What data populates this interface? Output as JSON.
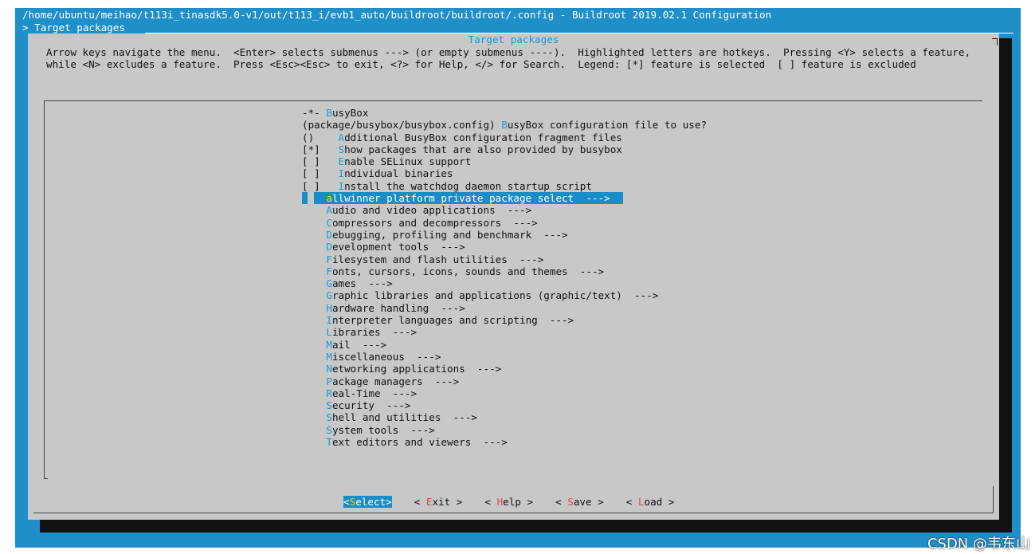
{
  "window": {
    "title": "/home/ubuntu/meihao/t113i_tinasdk5.0-v1/out/t113_i/evb1_auto/buildroot/buildroot/.config - Buildroot 2019.02.1 Configuration",
    "breadcrumb": "> Target packages"
  },
  "dialog": {
    "title": "Target packages",
    "help_line1": "Arrow keys navigate the menu.  <Enter> selects submenus ---> (or empty submenus ----).  Highlighted letters are hotkeys.  Pressing <Y> selects a feature,",
    "help_line2": "while <N> excludes a feature.  Press <Esc><Esc> to exit, <?> for Help, </> for Search.  Legend: [*] feature is selected  [ ] feature is excluded"
  },
  "menu": [
    {
      "prefix": "-*- ",
      "hot": "B",
      "rest": "usyBox"
    },
    {
      "prefix": "(package/busybox/busybox.config) ",
      "hot": "B",
      "rest": "usyBox configuration file to use?"
    },
    {
      "prefix": "()    ",
      "hot": "A",
      "rest": "dditional BusyBox configuration fragment files"
    },
    {
      "prefix": "[*]   ",
      "hot": "S",
      "rest": "how packages that are also provided by busybox"
    },
    {
      "prefix": "[ ]   ",
      "hot": "E",
      "rest": "nable SELinux support"
    },
    {
      "prefix": "[ ]   ",
      "hot": "I",
      "rest": "ndividual binaries"
    },
    {
      "prefix": "[ ]   ",
      "hot": "I",
      "rest": "nstall the watchdog daemon startup script"
    },
    {
      "prefix": "    ",
      "hot": "a",
      "rest": "llwinner platform private package select  --->",
      "selected": true
    },
    {
      "prefix": "    ",
      "hot": "A",
      "rest": "udio and video applications  --->"
    },
    {
      "prefix": "    ",
      "hot": "C",
      "rest": "ompressors and decompressors  --->"
    },
    {
      "prefix": "    ",
      "hot": "D",
      "rest": "ebugging, profiling and benchmark  --->"
    },
    {
      "prefix": "    ",
      "hot": "D",
      "rest": "evelopment tools  --->"
    },
    {
      "prefix": "    ",
      "hot": "F",
      "rest": "ilesystem and flash utilities  --->"
    },
    {
      "prefix": "    ",
      "hot": "F",
      "rest": "onts, cursors, icons, sounds and themes  --->"
    },
    {
      "prefix": "    ",
      "hot": "G",
      "rest": "ames  --->"
    },
    {
      "prefix": "    ",
      "hot": "G",
      "rest": "raphic libraries and applications (graphic/text)  --->"
    },
    {
      "prefix": "    ",
      "hot": "H",
      "pre": "",
      "rest": "ardware handling  --->",
      "hot_index": 1,
      "text": "Hardware handling  --->"
    },
    {
      "prefix": "    ",
      "hot": "I",
      "rest": "nterpreter languages and scripting  --->"
    },
    {
      "prefix": "    ",
      "hot": "L",
      "rest": "ibraries  --->"
    },
    {
      "prefix": "    ",
      "hot": "M",
      "rest": "ail  --->"
    },
    {
      "prefix": "    ",
      "hot": "M",
      "rest": "iscellaneous  --->"
    },
    {
      "prefix": "    ",
      "hot": "N",
      "rest": "etworking applications  --->"
    },
    {
      "prefix": "    ",
      "hot": "P",
      "rest": "ackage managers  --->"
    },
    {
      "prefix": "    ",
      "hot": "R",
      "rest": "eal-Time  --->"
    },
    {
      "prefix": "    ",
      "hot": "S",
      "rest": "ecurity  --->"
    },
    {
      "prefix": "    ",
      "hot": "S",
      "rest": "hell and utilities  --->"
    },
    {
      "prefix": "    ",
      "hot": "S",
      "rest": "ystem tools  --->"
    },
    {
      "prefix": "    ",
      "hot": "T",
      "rest": "ext editors and viewers  --->"
    }
  ],
  "buttons": [
    {
      "open": "<",
      "hot": "S",
      "rest": "elect",
      "close": ">",
      "active": true
    },
    {
      "open": "< ",
      "hot": "E",
      "rest": "xit",
      "close": " >"
    },
    {
      "open": "< ",
      "hot": "H",
      "rest": "elp",
      "close": " >"
    },
    {
      "open": "< ",
      "hot": "S",
      "rest": "ave",
      "close": " >"
    },
    {
      "open": "< ",
      "hot": "L",
      "rest": "oad",
      "close": " >"
    }
  ],
  "watermark": "CSDN @韦东山"
}
